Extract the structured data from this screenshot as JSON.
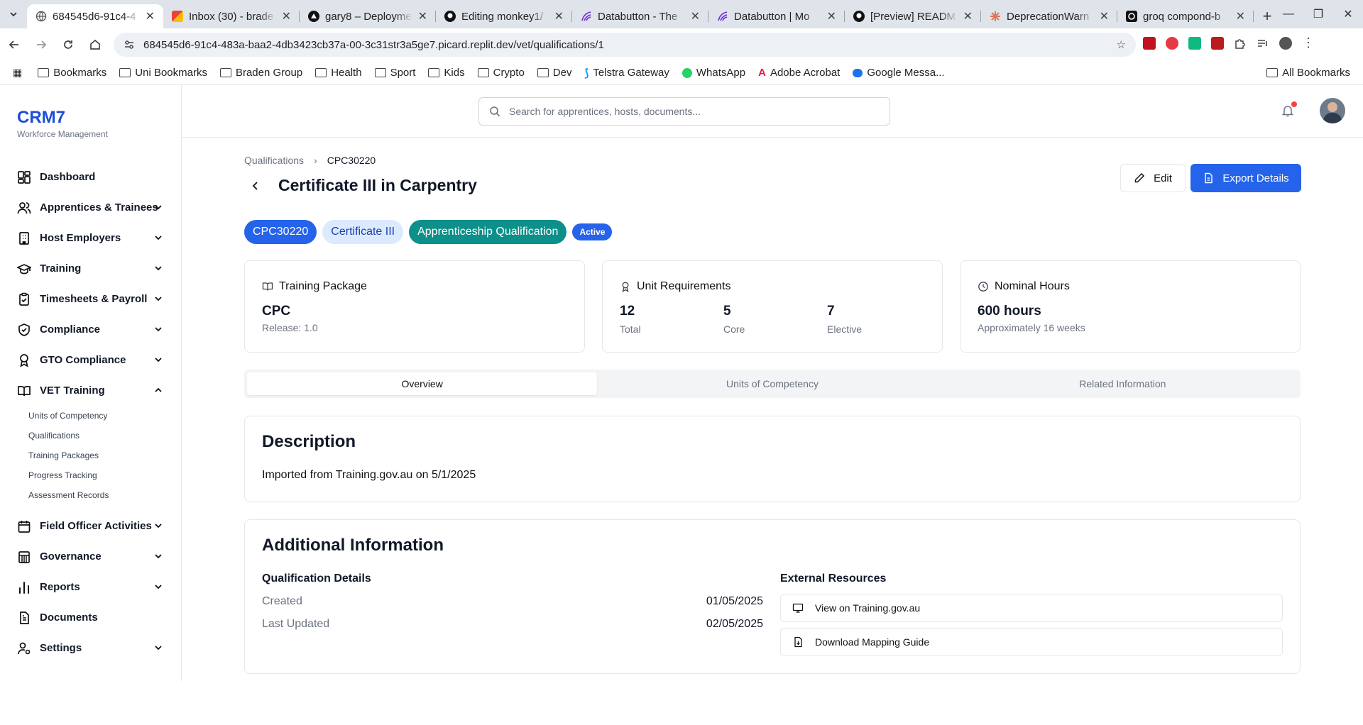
{
  "browser": {
    "tabs": [
      {
        "title": "684545d6-91c4-4",
        "active": true,
        "favicon": "globe-icon"
      },
      {
        "title": "Inbox (30) - brade",
        "favicon": "gmail-icon"
      },
      {
        "title": "gary8 – Deployme",
        "favicon": "vercel-icon"
      },
      {
        "title": "Editing monkey1/",
        "favicon": "github-icon"
      },
      {
        "title": "Databutton - The",
        "favicon": "databutton-icon"
      },
      {
        "title": "Databutton | Mo",
        "favicon": "databutton-icon"
      },
      {
        "title": "[Preview] READM",
        "favicon": "github-icon"
      },
      {
        "title": "DeprecationWarn",
        "favicon": "claude-icon"
      },
      {
        "title": "groq compond-b",
        "favicon": "groq-icon"
      }
    ],
    "url": "684545d6-91c4-483a-baa2-4db3423cb37a-00-3c31str3a5ge7.picard.replit.dev/vet/qualifications/1",
    "bookmarks": [
      "Bookmarks",
      "Uni Bookmarks",
      "Braden Group",
      "Health",
      "Sport",
      "Kids",
      "Crypto",
      "Dev",
      "Telstra Gateway",
      "WhatsApp",
      "Adobe Acrobat",
      "Google Messa..."
    ],
    "all_bookmarks": "All Bookmarks"
  },
  "sidebar": {
    "brand": "CRM7",
    "brand_sub": "Workforce Management",
    "items": [
      {
        "label": "Dashboard",
        "icon": "dashboard-icon"
      },
      {
        "label": "Apprentices & Trainees",
        "icon": "users-icon",
        "expandable": true
      },
      {
        "label": "Host Employers",
        "icon": "building-icon",
        "expandable": true
      },
      {
        "label": "Training",
        "icon": "graduation-cap-icon",
        "expandable": true
      },
      {
        "label": "Timesheets & Payroll",
        "icon": "clipboard-icon",
        "expandable": true
      },
      {
        "label": "Compliance",
        "icon": "shield-check-icon",
        "expandable": true
      },
      {
        "label": "GTO Compliance",
        "icon": "award-icon",
        "expandable": true
      },
      {
        "label": "VET Training",
        "icon": "book-open-icon",
        "expandable": true,
        "expanded": true
      },
      {
        "label": "Field Officer Activities",
        "icon": "calendar-icon",
        "expandable": true
      },
      {
        "label": "Governance",
        "icon": "landmark-icon",
        "expandable": true
      },
      {
        "label": "Reports",
        "icon": "bar-chart-icon",
        "expandable": true
      },
      {
        "label": "Documents",
        "icon": "file-text-icon"
      },
      {
        "label": "Settings",
        "icon": "user-cog-icon",
        "expandable": true
      }
    ],
    "vet_subitems": [
      "Units of Competency",
      "Qualifications",
      "Training Packages",
      "Progress Tracking",
      "Assessment Records"
    ]
  },
  "topbar": {
    "search_placeholder": "Search for apprentices, hosts, documents..."
  },
  "page": {
    "breadcrumb": [
      "Qualifications",
      "CPC30220"
    ],
    "title": "Certificate III in Carpentry",
    "edit_label": "Edit",
    "export_label": "Export Details",
    "badges": [
      "CPC30220",
      "Certificate III",
      "Apprenticeship Qualification",
      "Active"
    ],
    "cards": {
      "package": {
        "heading": "Training Package",
        "value": "CPC",
        "sub": "Release: 1.0"
      },
      "units": {
        "heading": "Unit Requirements",
        "total": "12",
        "total_label": "Total",
        "core": "5",
        "core_label": "Core",
        "elective": "7",
        "elective_label": "Elective"
      },
      "hours": {
        "heading": "Nominal Hours",
        "value": "600 hours",
        "sub": "Approximately 16 weeks"
      }
    },
    "tabs": [
      "Overview",
      "Units of Competency",
      "Related Information"
    ],
    "description": {
      "heading": "Description",
      "text": "Imported from Training.gov.au on 5/1/2025"
    },
    "additional": {
      "heading": "Additional Information",
      "details_heading": "Qualification Details",
      "created_label": "Created",
      "created": "01/05/2025",
      "updated_label": "Last Updated",
      "updated": "02/05/2025",
      "resources_heading": "External Resources",
      "resources": [
        "View on Training.gov.au",
        "Download Mapping Guide"
      ]
    }
  }
}
